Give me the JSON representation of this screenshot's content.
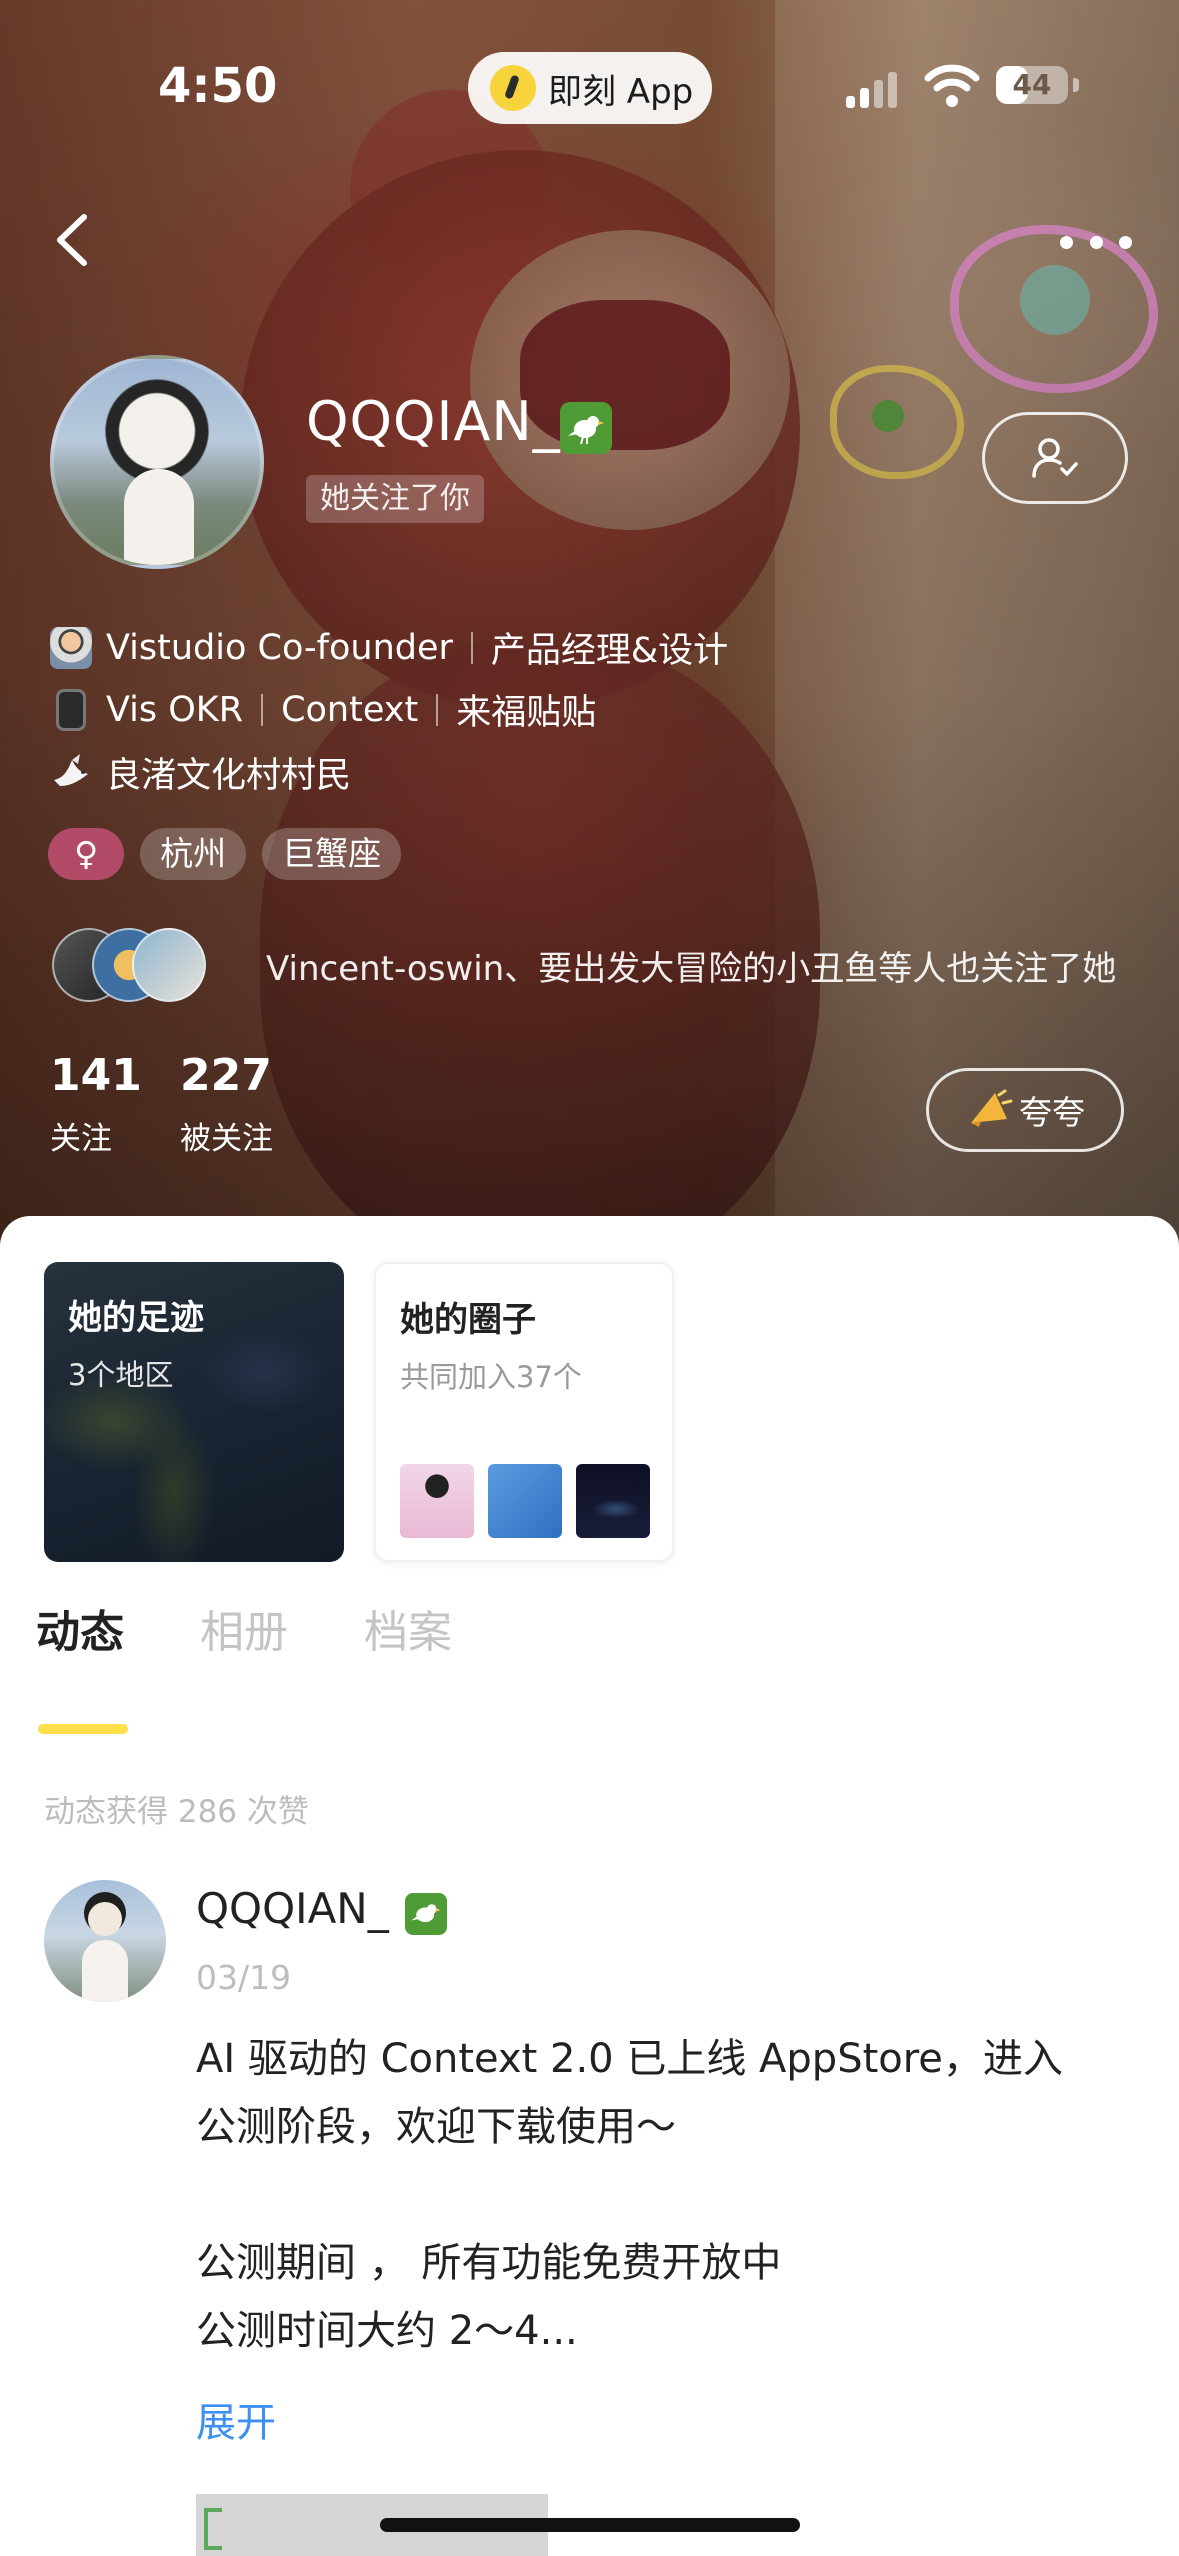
{
  "status_bar": {
    "time": "4:50",
    "island_app": "即刻 App",
    "battery": "44",
    "battery_level": 0.44
  },
  "profile": {
    "username": "QQQIAN_",
    "follows_you": "她关注了你",
    "bio": [
      {
        "icon": "technologist-emoji-icon",
        "parts": [
          "Vistudio Co-founder",
          "产品经理&设计"
        ]
      },
      {
        "icon": "phone-emoji-icon",
        "parts": [
          "Vis OKR",
          "Context",
          "来福贴贴"
        ]
      },
      {
        "icon": "dove-emoji-icon",
        "parts": [
          "良渚文化村村民"
        ]
      }
    ],
    "tags": {
      "gender": "♀",
      "city": "杭州",
      "zodiac": "巨蟹座"
    },
    "mutual_text": "Vincent-oswin、要出发大冒险的小丑鱼等人也关注了她",
    "following_count": "141",
    "following_label": "关注",
    "followers_count": "227",
    "followers_label": "被关注",
    "praise_label": "夸夸"
  },
  "cards": {
    "footprint": {
      "title": "她的足迹",
      "subtitle": "3个地区"
    },
    "circles": {
      "title": "她的圈子",
      "subtitle": "共同加入37个"
    }
  },
  "tabs": [
    "动态",
    "相册",
    "档案"
  ],
  "likes_note": "动态获得 286 次赞",
  "post": {
    "author": "QQQIAN_",
    "date": "03/19",
    "lines": [
      "AI 驱动的 Context 2.0 已上线 AppStore，进入",
      "公测阶段，欢迎下载使用～",
      "",
      "公测期间 ， 所有功能免费开放中",
      "公测时间大约 2～4..."
    ],
    "expand": "展开"
  },
  "colors": {
    "accent_yellow": "#ffe04a",
    "link_blue": "#3f8ff0",
    "badge_green": "#4f9b35",
    "gender_tag": "#b04a66"
  }
}
